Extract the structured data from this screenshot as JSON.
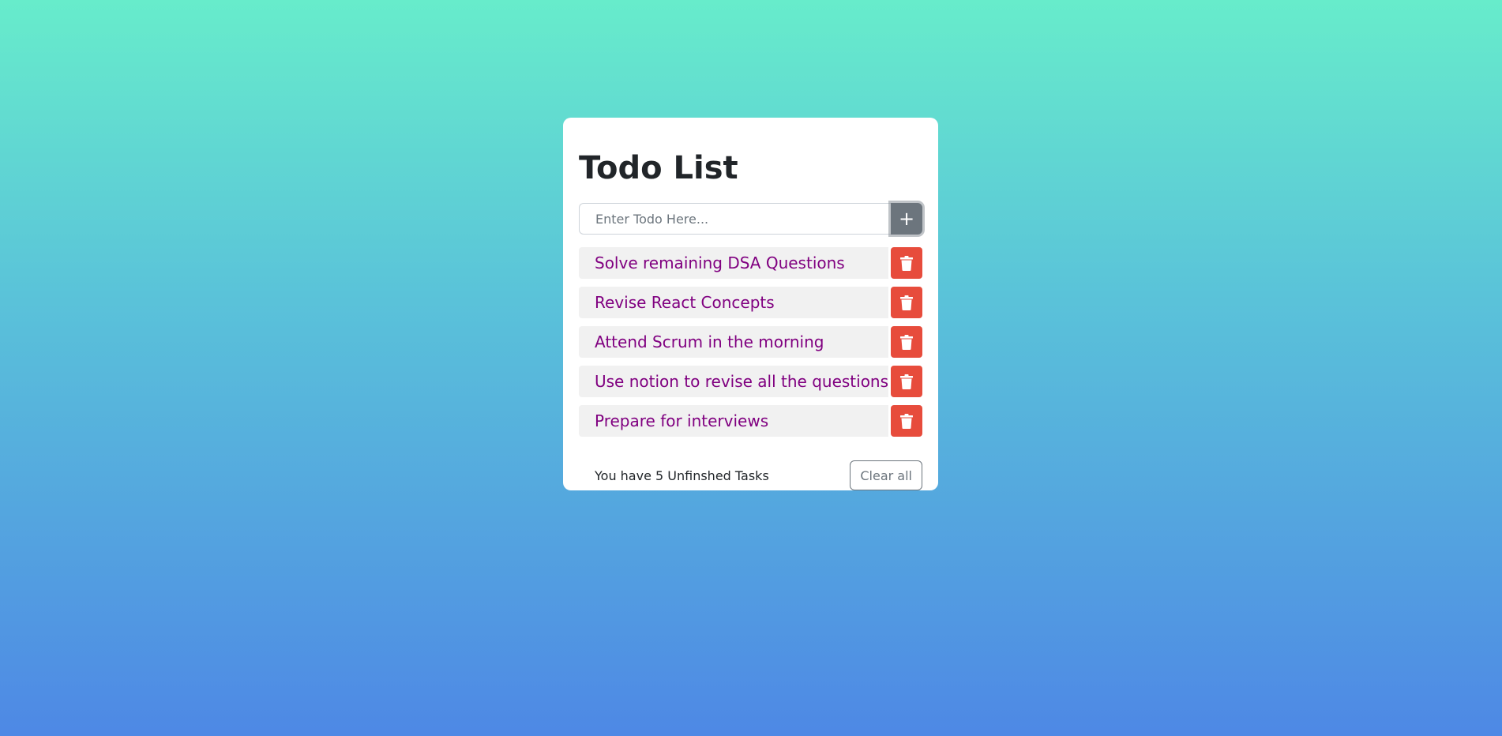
{
  "app": {
    "title": "Todo List"
  },
  "input": {
    "placeholder": "Enter Todo Here...",
    "value": ""
  },
  "add_button": {
    "label": "+",
    "icon": "plus-icon"
  },
  "todos": [
    {
      "text": "Solve remaining DSA Questions",
      "delete_icon": "trash-icon"
    },
    {
      "text": "Revise React Concepts",
      "delete_icon": "trash-icon"
    },
    {
      "text": "Attend Scrum in the morning",
      "delete_icon": "trash-icon"
    },
    {
      "text": "Use notion to revise all the questions",
      "delete_icon": "trash-icon"
    },
    {
      "text": "Prepare for interviews",
      "delete_icon": "trash-icon"
    }
  ],
  "footer": {
    "status_text": "You have 5 Unfinshed Tasks",
    "clear_label": "Clear all"
  },
  "colors": {
    "todo_text": "#800080",
    "delete_button": "#e74c3c",
    "add_button": "#6c757d",
    "gradient_top": "#67eccb",
    "gradient_bottom": "#4e88e5"
  }
}
